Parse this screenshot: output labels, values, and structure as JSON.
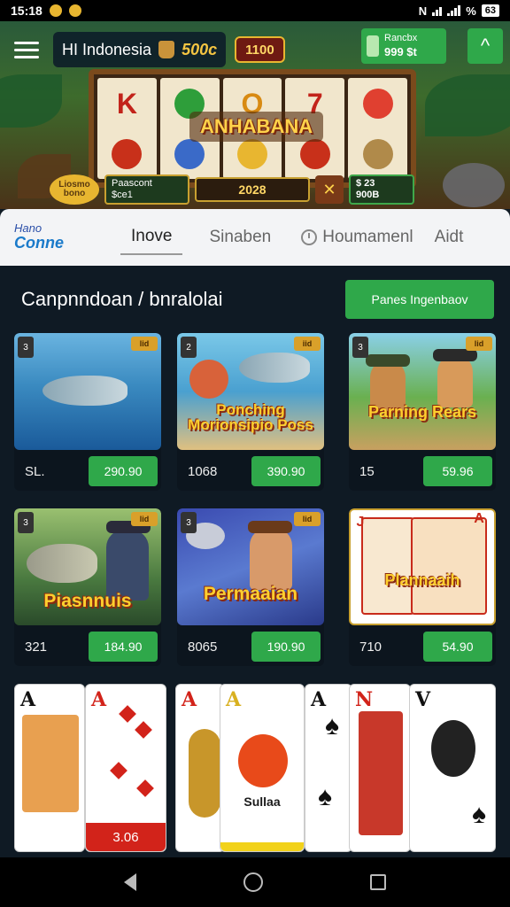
{
  "status": {
    "time": "15:18",
    "battery": "63",
    "right_glyph": "N",
    "percent_sign": "%"
  },
  "header": {
    "region_label": "HI Indonesia",
    "coins": "500c",
    "jackpot": "1100",
    "wallet_title": "Rancbx",
    "wallet_value": "999 $t",
    "up_glyph": "^"
  },
  "slot": {
    "title": "ANHABANA",
    "bonus_coin": "Liosmo bono",
    "bonus_info_title": "Paascont",
    "bonus_info_value": "$ce1",
    "bet": "2028",
    "win_line1": "$ 23",
    "win_line2": "900B"
  },
  "tabs": {
    "logo_line1": "Hano",
    "logo_line2": "Conne",
    "items": [
      "Inove",
      "Sinaben",
      "Houmamenl",
      "Aidt"
    ]
  },
  "section": {
    "title": "Canpnndoan / bnralolai",
    "button": "Panes Ingenbaov"
  },
  "games": [
    {
      "badge_left": "3",
      "badge_right": "lid",
      "title": "",
      "num": "SL.",
      "price": "290.90"
    },
    {
      "badge_left": "2",
      "badge_right": "iid",
      "title": "Ponching Morionsipio Poss",
      "num": "1068",
      "price": "390.90"
    },
    {
      "badge_left": "3",
      "badge_right": "lid",
      "title": "Parning Rears",
      "num": "15",
      "price": "59.96"
    },
    {
      "badge_left": "3",
      "badge_right": "lid",
      "title": "Piasnnuis",
      "num": "321",
      "price": "184.90"
    },
    {
      "badge_left": "3",
      "badge_right": "lid",
      "title": "Permaaian",
      "num": "8065",
      "price": "190.90"
    },
    {
      "badge_left": "J",
      "badge_right": "A",
      "title": "Plannaaih",
      "num": "710",
      "price": "54.90"
    }
  ],
  "playing_cards": {
    "card1_index": "A",
    "card2_index": "A",
    "card2_price": "3.06",
    "card3_index": "A",
    "card4_index": "A",
    "card4_text": "Sullaa",
    "card5_index": "A",
    "card6_index": "N",
    "card7_index": "A",
    "card8_index": "V"
  },
  "colors": {
    "accent_green": "#2fa84a",
    "gold": "#e8b630",
    "background": "#0f1a24"
  },
  "icons": [
    "menu-icon",
    "bag-icon",
    "wallet-icon",
    "arrow-up-icon",
    "tools-icon",
    "clock-icon",
    "back-icon",
    "home-icon",
    "recent-apps-icon"
  ]
}
